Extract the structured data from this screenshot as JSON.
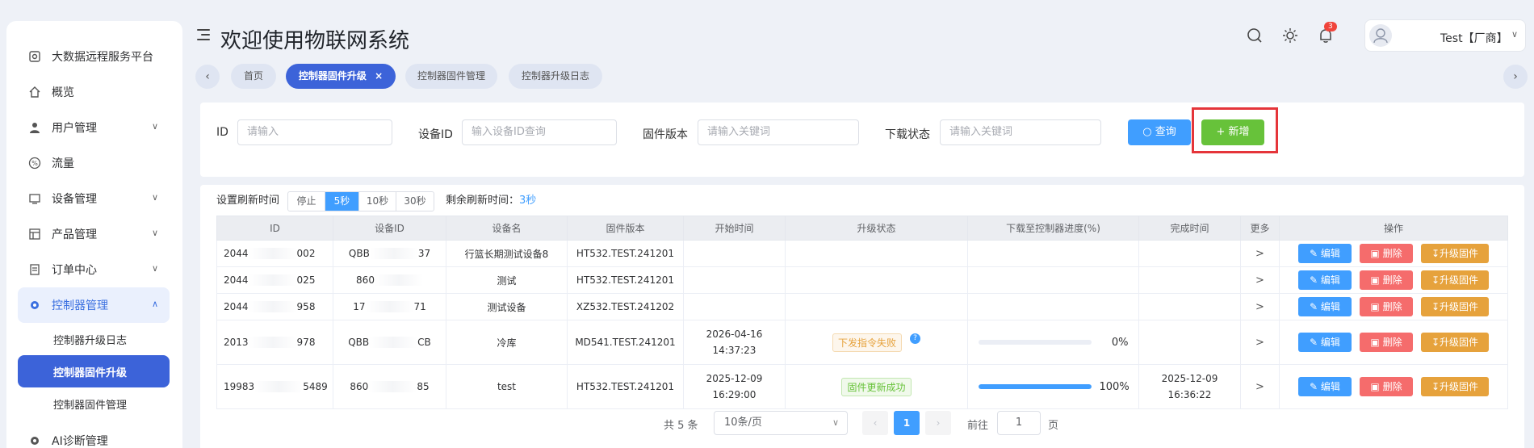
{
  "header": {
    "title": "欢迎使用物联网系统",
    "notification_count": "3",
    "user_name": "Test【厂商】"
  },
  "sidebar": {
    "items": [
      {
        "label": "大数据远程服务平台",
        "icon": "monitor-icon"
      },
      {
        "label": "概览",
        "icon": "home-icon"
      },
      {
        "label": "用户管理",
        "icon": "user-icon"
      },
      {
        "label": "流量",
        "icon": "percent-icon"
      },
      {
        "label": "设备管理",
        "icon": "device-icon"
      },
      {
        "label": "产品管理",
        "icon": "product-icon"
      },
      {
        "label": "订单中心",
        "icon": "order-icon"
      },
      {
        "label": "控制器管理",
        "icon": "gear-icon"
      },
      {
        "label": "AI诊断管理",
        "icon": "gear-icon"
      }
    ],
    "sub_items": [
      {
        "label": "控制器升级日志"
      },
      {
        "label": "控制器固件升级"
      },
      {
        "label": "控制器固件管理"
      }
    ]
  },
  "tabs": [
    {
      "label": "首页"
    },
    {
      "label": "控制器固件升级"
    },
    {
      "label": "控制器固件管理"
    },
    {
      "label": "控制器升级日志"
    }
  ],
  "search": {
    "id_label": "ID",
    "id_placeholder": "请输入",
    "device_id_label": "设备ID",
    "device_id_placeholder": "输入设备ID查询",
    "firmware_label": "固件版本",
    "firmware_placeholder": "请输入关键词",
    "download_label": "下载状态",
    "download_placeholder": "请输入关键词",
    "query_label": "查询",
    "add_label": "新增"
  },
  "refresh": {
    "label": "设置刷新时间",
    "options": [
      "停止",
      "5秒",
      "10秒",
      "30秒"
    ],
    "selected": "5秒",
    "remain_label": "剩余刷新时间：",
    "remain_value": "3秒"
  },
  "table": {
    "columns": [
      "ID",
      "设备ID",
      "设备名",
      "固件版本",
      "开始时间",
      "升级状态",
      "下载至控制器进度(%)",
      "完成时间",
      "更多",
      "操作"
    ],
    "rows": [
      {
        "id_a": "2044",
        "id_b": "002",
        "dev_a": "QBB",
        "dev_b": "37",
        "name": "行篮长期测试设备8",
        "firmware": "HT532.TEST.241201",
        "start_date": "",
        "start_time": "",
        "status": "",
        "progress": null,
        "progress_text": "",
        "end_date": "",
        "end_time": ""
      },
      {
        "id_a": "2044",
        "id_b": "025",
        "dev_a": "860",
        "dev_b": "",
        "name": "测试",
        "firmware": "HT532.TEST.241201",
        "start_date": "",
        "start_time": "",
        "status": "",
        "progress": null,
        "progress_text": "",
        "end_date": "",
        "end_time": ""
      },
      {
        "id_a": "2044",
        "id_b": "958",
        "dev_a": "17",
        "dev_b": "71",
        "name": "测试设备",
        "firmware": "XZ532.TEST.241202",
        "start_date": "",
        "start_time": "",
        "status": "",
        "progress": null,
        "progress_text": "",
        "end_date": "",
        "end_time": ""
      },
      {
        "id_a": "2013",
        "id_b": "978",
        "dev_a": "QBB",
        "dev_b": "CB",
        "name": "冷库",
        "firmware": "MD541.TEST.241201",
        "start_date": "2026-04-16",
        "start_time": "14:37:23",
        "status": "下发指令失败",
        "progress": 0,
        "progress_text": "0%",
        "end_date": "",
        "end_time": ""
      },
      {
        "id_a": "19983",
        "id_b": "5489",
        "dev_a": "860",
        "dev_b": "85",
        "name": "test",
        "firmware": "HT532.TEST.241201",
        "start_date": "2025-12-09",
        "start_time": "16:29:00",
        "status": "固件更新成功",
        "progress": 1.0,
        "progress_text": "100%",
        "end_date": "2025-12-09",
        "end_time": "16:36:22"
      }
    ],
    "more_symbol": ">",
    "action_edit": "编辑",
    "action_delete": "删除",
    "action_upgrade": "升级固件"
  },
  "pagination": {
    "total": "共 5 条",
    "page_size": "10条/页",
    "current_page": "1",
    "goto_label": "前往",
    "goto_value": "1",
    "page_label": "页"
  },
  "colors": {
    "primary": "#409eff",
    "success": "#67c23a",
    "danger": "#f56c6c",
    "warning": "#e6a23c",
    "active_nav": "#3c63d9",
    "highlight_box": "#e5353a"
  }
}
